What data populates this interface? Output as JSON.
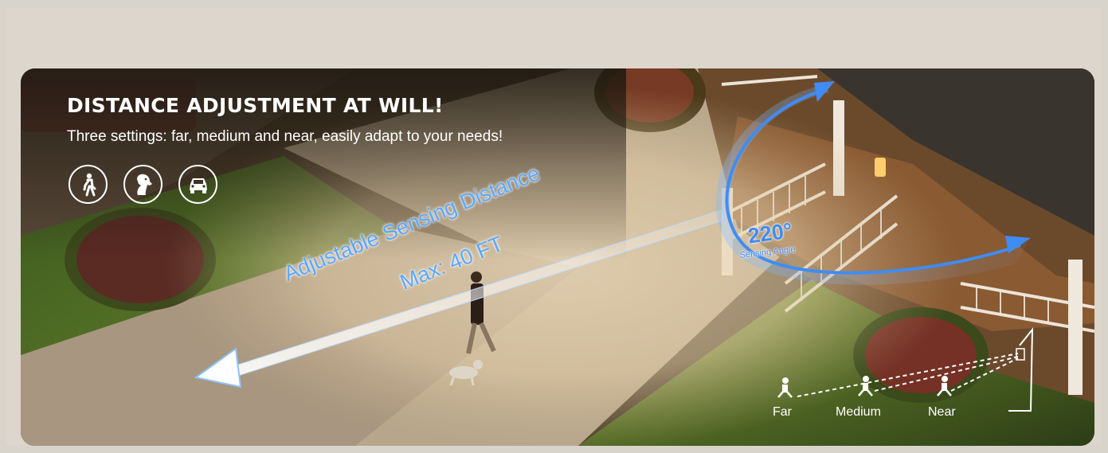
{
  "banner": {
    "headline": "DISTANCE ADJUSTMENT AT WILL!",
    "subline": "Three settings: far, medium and near, easily adapt to your needs!",
    "detect_icons": [
      "person-icon",
      "dog-icon",
      "car-icon"
    ],
    "distance_line1": "Adjustable Sensing Distance",
    "distance_line2": "Max: 40 FT",
    "angle_value": "220°",
    "angle_caption": "Sensing Angle",
    "ranges": [
      "Far",
      "Medium",
      "Near"
    ],
    "accent_color": "#3f8cf5"
  }
}
